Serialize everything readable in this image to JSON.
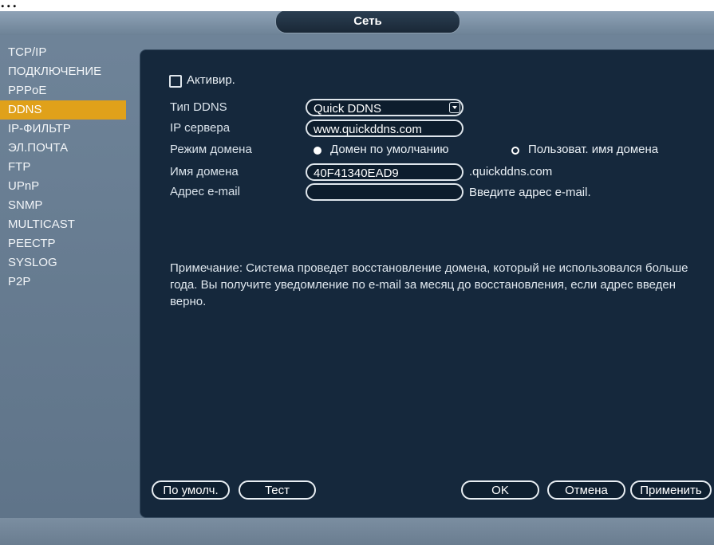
{
  "document_top_text": "...",
  "window": {
    "title": "Сеть"
  },
  "sidebar": {
    "items": [
      {
        "label": "TCP/IP",
        "active": false
      },
      {
        "label": "ПОДКЛЮЧЕНИЕ",
        "active": false
      },
      {
        "label": "PPPoE",
        "active": false
      },
      {
        "label": "DDNS",
        "active": true
      },
      {
        "label": "IP-ФИЛЬТР",
        "active": false
      },
      {
        "label": "ЭЛ.ПОЧТА",
        "active": false
      },
      {
        "label": "FTP",
        "active": false
      },
      {
        "label": "UPnP",
        "active": false
      },
      {
        "label": "SNMP",
        "active": false
      },
      {
        "label": "MULTICAST",
        "active": false
      },
      {
        "label": "РЕЕСТР",
        "active": false
      },
      {
        "label": "SYSLOG",
        "active": false
      },
      {
        "label": "P2P",
        "active": false
      }
    ]
  },
  "form": {
    "enable_label": "Активир.",
    "enable_checked": false,
    "ddns_type_label": "Тип DDNS",
    "ddns_type_value": "Quick DDNS",
    "server_ip_label": "IP сервера",
    "server_ip_value": "www.quickddns.com",
    "domain_mode_label": "Режим домена",
    "domain_mode_default": "Домен по умолчанию",
    "domain_mode_custom": "Пользоват. имя домена",
    "domain_mode_selected": "default",
    "domain_name_label": "Имя домена",
    "domain_name_value": "40F41340EAD9",
    "domain_suffix": ".quickddns.com",
    "email_label": "Адрес e-mail",
    "email_value": "",
    "email_hint": "Введите адрес e-mail.",
    "note": "Примечание: Система проведет восстановление домена, который не использовался больше года. Вы получите уведомление по e-mail за месяц до восстановления, если адрес введен верно."
  },
  "buttons": {
    "default": "По умолч.",
    "test": "Тест",
    "ok": "OK",
    "cancel": "Отмена",
    "apply": "Применить"
  },
  "colors": {
    "accent": "#e0a11a",
    "panel_bg": "#15283c",
    "screen_bg": "#6f8499"
  }
}
